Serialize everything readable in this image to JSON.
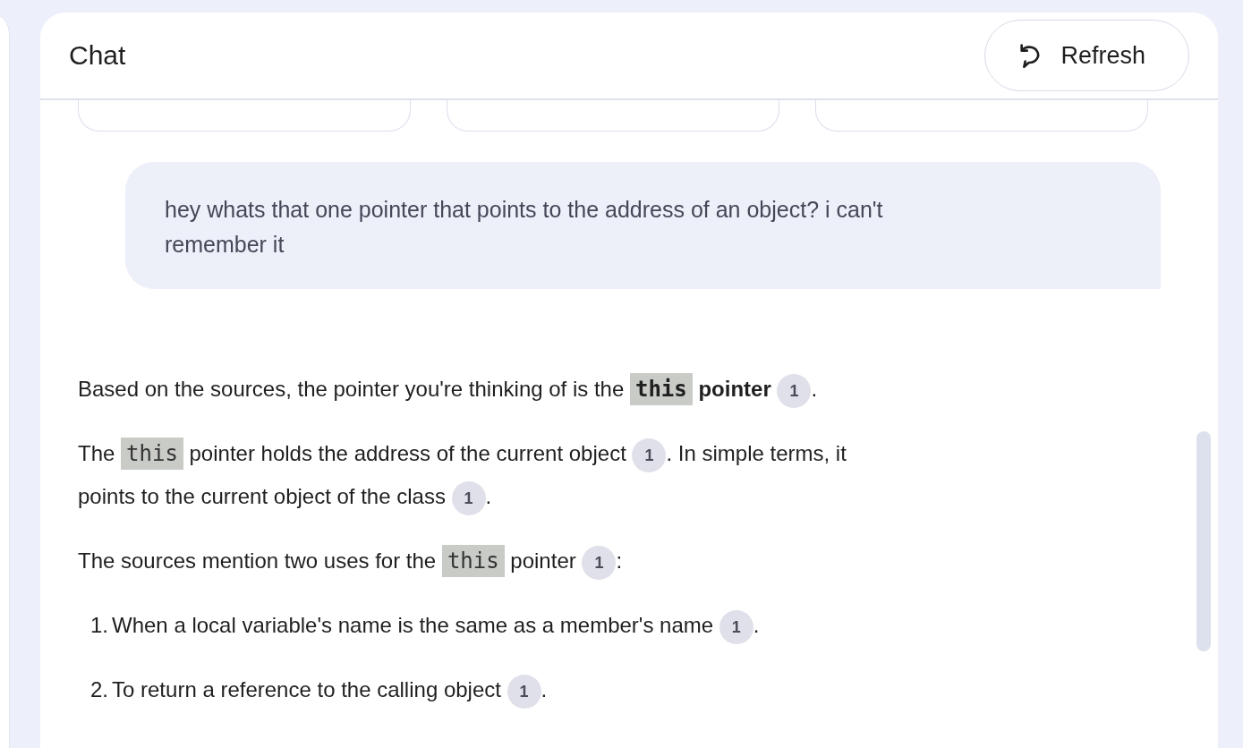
{
  "panel": {
    "title": "Chat",
    "refresh_button": "Refresh"
  },
  "suggestion_cards": [
    {
      "kind": "card"
    },
    {
      "kind": "card"
    },
    {
      "kind": "card"
    }
  ],
  "user_message": "hey whats that one pointer that points to the address of an object? i can't remember it",
  "response": [
    {
      "kind": "paragraph",
      "segments": [
        {
          "kind": "text",
          "text": "Based on the sources, the pointer you're thinking of is the"
        },
        {
          "kind": "code",
          "text": "this",
          "bold": true
        },
        {
          "kind": "text",
          "text": "**pointer**"
        },
        {
          "kind": "citation",
          "text": "1"
        },
        {
          "kind": "text",
          "text": "."
        }
      ]
    },
    {
      "kind": "paragraph",
      "segments": [
        {
          "kind": "text",
          "text": "The"
        },
        {
          "kind": "code",
          "text": "this",
          "bold": false
        },
        {
          "kind": "text",
          "text": "pointer holds the address of the current object"
        },
        {
          "kind": "citation",
          "text": "1"
        },
        {
          "kind": "text",
          "text": ". In simple terms, it"
        },
        {
          "kind": "text",
          "text": "points to the current object of the class"
        },
        {
          "kind": "citation",
          "text": "1"
        },
        {
          "kind": "text",
          "text": "."
        }
      ]
    },
    {
      "kind": "paragraph",
      "segments": [
        {
          "kind": "text",
          "text": "The sources mention two uses for the"
        },
        {
          "kind": "code",
          "text": "this",
          "bold": false
        },
        {
          "kind": "text",
          "text": "pointer"
        },
        {
          "kind": "citation",
          "text": "1"
        },
        {
          "kind": "text",
          "text": ":"
        }
      ]
    },
    {
      "kind": "list_item",
      "marker": "1.",
      "segments": [
        {
          "kind": "text",
          "text": "When a local variable's name is the same as a member's name"
        },
        {
          "kind": "citation",
          "text": "1"
        },
        {
          "kind": "text",
          "text": "."
        }
      ]
    },
    {
      "kind": "list_item",
      "marker": "2.",
      "segments": [
        {
          "kind": "text",
          "text": "To return a reference to the calling object"
        },
        {
          "kind": "citation",
          "text": "1"
        },
        {
          "kind": "text",
          "text": "."
        }
      ]
    }
  ]
}
